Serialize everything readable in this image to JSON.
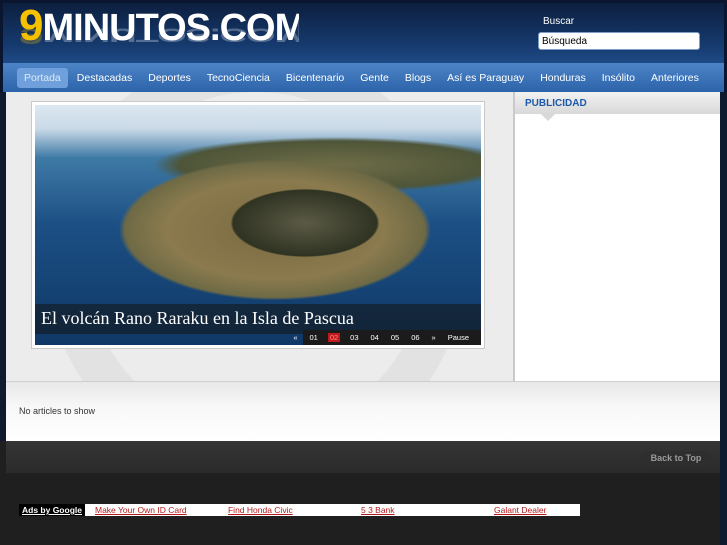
{
  "header": {
    "logo_nine": "9",
    "logo_rest": "MINUTOS.COM",
    "search_label": "Buscar",
    "search_value": "Búsqueda"
  },
  "nav": {
    "items": [
      "Portada",
      "Destacadas",
      "Deportes",
      "TecnoCiencia",
      "Bicentenario",
      "Gente",
      "Blogs",
      "Así es Paraguay",
      "Honduras",
      "Insólito",
      "Anteriores"
    ],
    "active_index": 0
  },
  "slider": {
    "caption": "El volcán Rano Raraku en la Isla de Pascua",
    "prev": "«",
    "pages": [
      "01",
      "02",
      "03",
      "04",
      "05",
      "06"
    ],
    "active_page": "02",
    "next": "»",
    "pause": "Pause"
  },
  "sidebar": {
    "heading": "PUBLICIDAD"
  },
  "articles": {
    "empty_message": "No articles to show"
  },
  "footer": {
    "back_to_top": "Back to Top",
    "ads_by": "Ads by Google",
    "ad_links": [
      "Make Your Own ID Card",
      "Find Honda Civic",
      "5 3 Bank",
      "Galant Dealer"
    ]
  },
  "colors": {
    "header_bg": "#163a6e",
    "nav_bg": "#3a72b8",
    "accent": "#f6c200",
    "ad_link": "#b31b1b",
    "sidebar_heading": "#1c59a8"
  }
}
